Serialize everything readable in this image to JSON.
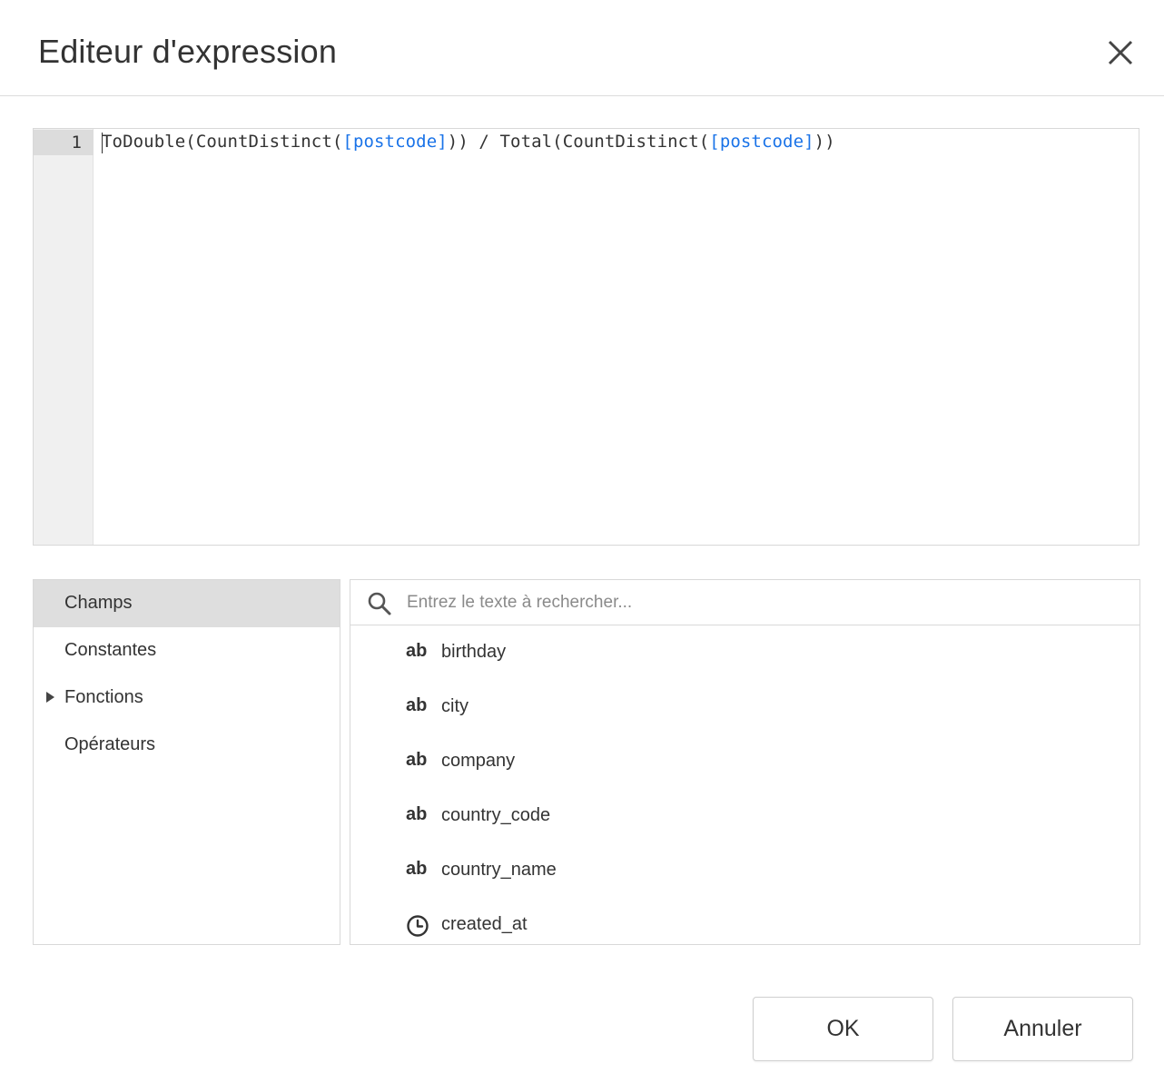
{
  "dialog": {
    "title": "Editeur d'expression",
    "close_icon": "close-icon"
  },
  "editor": {
    "line_number": "1",
    "code_segments": [
      {
        "text": "ToDouble(CountDistinct(",
        "kind": "plain"
      },
      {
        "text": "[postcode]",
        "kind": "field"
      },
      {
        "text": ")) / Total(CountDistinct(",
        "kind": "plain"
      },
      {
        "text": "[postcode]",
        "kind": "field"
      },
      {
        "text": "))",
        "kind": "plain"
      }
    ]
  },
  "categories": [
    {
      "label": "Champs",
      "selected": true,
      "expandable": false
    },
    {
      "label": "Constantes",
      "selected": false,
      "expandable": false
    },
    {
      "label": "Fonctions",
      "selected": false,
      "expandable": true
    },
    {
      "label": "Opérateurs",
      "selected": false,
      "expandable": false
    }
  ],
  "search": {
    "placeholder": "Entrez le texte à rechercher...",
    "value": "",
    "icon": "search-icon"
  },
  "fields": [
    {
      "type_label": "ab",
      "type": "string",
      "name": "birthday"
    },
    {
      "type_label": "ab",
      "type": "string",
      "name": "city"
    },
    {
      "type_label": "ab",
      "type": "string",
      "name": "company"
    },
    {
      "type_label": "ab",
      "type": "string",
      "name": "country_code"
    },
    {
      "type_label": "ab",
      "type": "string",
      "name": "country_name"
    },
    {
      "type_label": "",
      "type": "datetime",
      "icon": "clock-icon",
      "name": "created_at"
    }
  ],
  "buttons": {
    "ok_label": "OK",
    "cancel_label": "Annuler"
  },
  "colors": {
    "field_reference": "#1a73e8",
    "selected_category_bg": "#dedede",
    "gutter_bg": "#f0f0f0"
  }
}
